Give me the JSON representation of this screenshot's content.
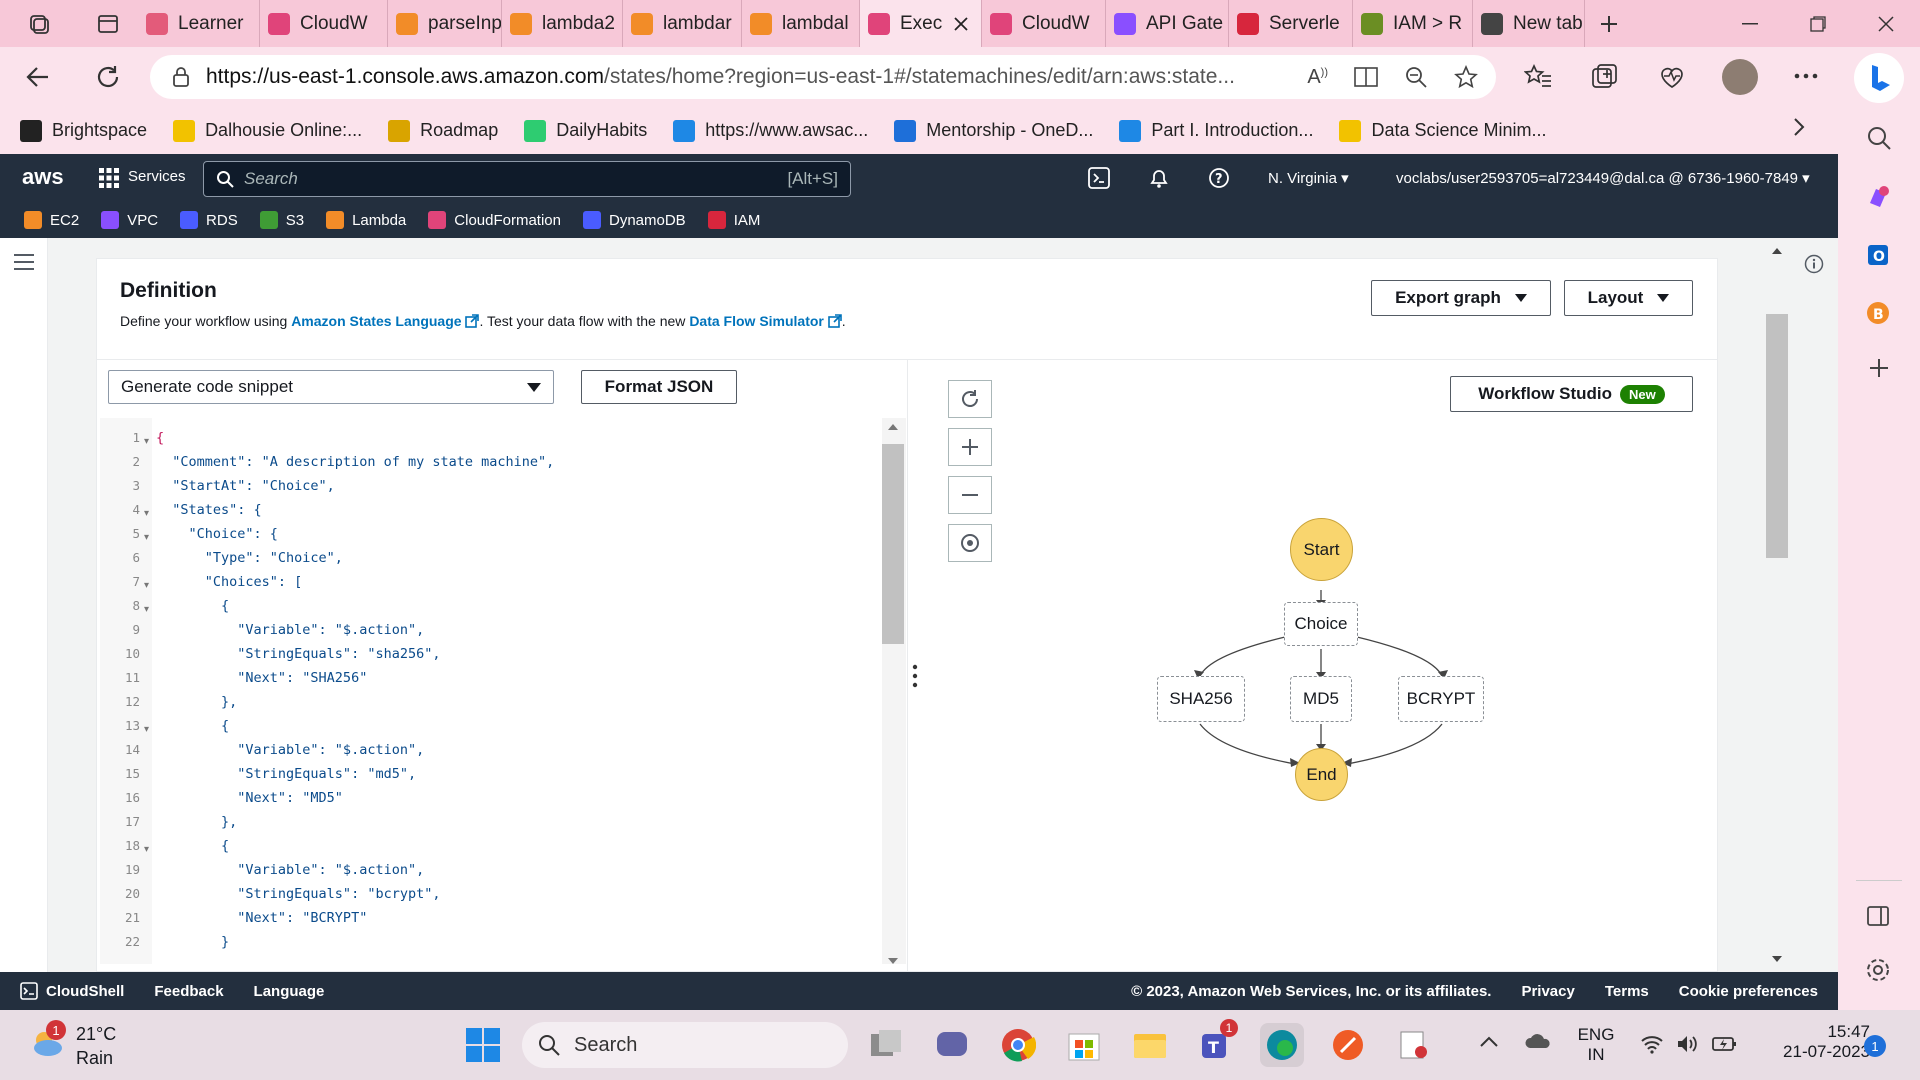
{
  "browser": {
    "tabs": [
      {
        "label": "Learner",
        "color": "#e35b7a"
      },
      {
        "label": "CloudW",
        "color": "#e0447a"
      },
      {
        "label": "parseInp",
        "color": "#f28c28"
      },
      {
        "label": "lambda2",
        "color": "#f28c28"
      },
      {
        "label": "lambdar",
        "color": "#f28c28"
      },
      {
        "label": "lambdal",
        "color": "#f28c28"
      },
      {
        "label": "Exec",
        "color": "#e0447a",
        "active": true
      },
      {
        "label": "CloudW",
        "color": "#e0447a"
      },
      {
        "label": "API Gate",
        "color": "#8a4fff"
      },
      {
        "label": "Serverle",
        "color": "#d7263d"
      },
      {
        "label": "IAM > R",
        "color": "#6b8e23"
      },
      {
        "label": "New tab",
        "color": "#444444"
      }
    ],
    "url_host": "https://us-east-1.console.aws.amazon.com",
    "url_path": "/states/home?region=us-east-1#/statemachines/edit/arn:aws:state...",
    "favorites": [
      {
        "label": "Brightspace",
        "color": "#222222",
        "icon": "d2l-icon"
      },
      {
        "label": "Dalhousie Online:...",
        "color": "#f2c200",
        "icon": "shield-icon"
      },
      {
        "label": "Roadmap",
        "color": "#d9a400",
        "icon": "lamp-icon"
      },
      {
        "label": "DailyHabits",
        "color": "#2ecc71",
        "icon": "check-icon"
      },
      {
        "label": "https://www.awsac...",
        "color": "#1e88e5",
        "icon": "cloud-icon"
      },
      {
        "label": "Mentorship - OneD...",
        "color": "#1e6fd9",
        "icon": "onedrive-icon"
      },
      {
        "label": "Part I. Introduction...",
        "color": "#1e88e5",
        "icon": "kn-icon"
      },
      {
        "label": "Data Science Minim...",
        "color": "#f2c200",
        "icon": "k-icon"
      }
    ]
  },
  "aws": {
    "logo": "aws",
    "services_label": "Services",
    "search_placeholder": "Search",
    "search_shortcut": "[Alt+S]",
    "region": "N. Virginia ▾",
    "account": "voclabs/user2593705=al723449@dal.ca @ 6736-1960-7849 ▾",
    "service_favs": [
      {
        "label": "EC2",
        "color": "#f28c28"
      },
      {
        "label": "VPC",
        "color": "#8a4fff"
      },
      {
        "label": "RDS",
        "color": "#4a5cff"
      },
      {
        "label": "S3",
        "color": "#3f9c35"
      },
      {
        "label": "Lambda",
        "color": "#f28c28"
      },
      {
        "label": "CloudFormation",
        "color": "#e0447a"
      },
      {
        "label": "DynamoDB",
        "color": "#4a5cff"
      },
      {
        "label": "IAM",
        "color": "#d7263d"
      }
    ]
  },
  "definition": {
    "title": "Definition",
    "desc_prefix": "Define your workflow using ",
    "link1": "Amazon States Language",
    "desc_mid": ". Test your data flow with the new ",
    "link2": "Data Flow Simulator",
    "desc_suffix": ".",
    "export_label": "Export graph",
    "layout_label": "Layout",
    "snippet_label": "Generate code snippet",
    "format_label": "Format JSON",
    "workflow_studio_label": "Workflow Studio",
    "new_badge": "New"
  },
  "code_lines": [
    {
      "n": "1",
      "fold": true,
      "text": "{"
    },
    {
      "n": "2",
      "fold": false,
      "text": "  \"Comment\": \"A description of my state machine\","
    },
    {
      "n": "3",
      "fold": false,
      "text": "  \"StartAt\": \"Choice\","
    },
    {
      "n": "4",
      "fold": true,
      "text": "  \"States\": {"
    },
    {
      "n": "5",
      "fold": true,
      "text": "    \"Choice\": {"
    },
    {
      "n": "6",
      "fold": false,
      "text": "      \"Type\": \"Choice\","
    },
    {
      "n": "7",
      "fold": true,
      "text": "      \"Choices\": ["
    },
    {
      "n": "8",
      "fold": true,
      "text": "        {"
    },
    {
      "n": "9",
      "fold": false,
      "text": "          \"Variable\": \"$.action\","
    },
    {
      "n": "10",
      "fold": false,
      "text": "          \"StringEquals\": \"sha256\","
    },
    {
      "n": "11",
      "fold": false,
      "text": "          \"Next\": \"SHA256\""
    },
    {
      "n": "12",
      "fold": false,
      "text": "        },"
    },
    {
      "n": "13",
      "fold": true,
      "text": "        {"
    },
    {
      "n": "14",
      "fold": false,
      "text": "          \"Variable\": \"$.action\","
    },
    {
      "n": "15",
      "fold": false,
      "text": "          \"StringEquals\": \"md5\","
    },
    {
      "n": "16",
      "fold": false,
      "text": "          \"Next\": \"MD5\""
    },
    {
      "n": "17",
      "fold": false,
      "text": "        },"
    },
    {
      "n": "18",
      "fold": true,
      "text": "        {"
    },
    {
      "n": "19",
      "fold": false,
      "text": "          \"Variable\": \"$.action\","
    },
    {
      "n": "20",
      "fold": false,
      "text": "          \"StringEquals\": \"bcrypt\","
    },
    {
      "n": "21",
      "fold": false,
      "text": "          \"Next\": \"BCRYPT\""
    },
    {
      "n": "22",
      "fold": false,
      "text": "        }"
    }
  ],
  "graph": {
    "start": "Start",
    "choice": "Choice",
    "branches": [
      "SHA256",
      "MD5",
      "BCRYPT"
    ],
    "end": "End"
  },
  "footer": {
    "cloudshell": "CloudShell",
    "feedback": "Feedback",
    "language": "Language",
    "copyright": "© 2023, Amazon Web Services, Inc. or its affiliates.",
    "privacy": "Privacy",
    "terms": "Terms",
    "cookies": "Cookie preferences"
  },
  "taskbar": {
    "weather_temp": "21°C",
    "weather_desc": "Rain",
    "weather_badge": "1",
    "search_label": "Search",
    "lang1": "ENG",
    "lang2": "IN",
    "time": "15:47",
    "date": "21-07-2023",
    "notif": "1",
    "teams_badge": "1"
  }
}
